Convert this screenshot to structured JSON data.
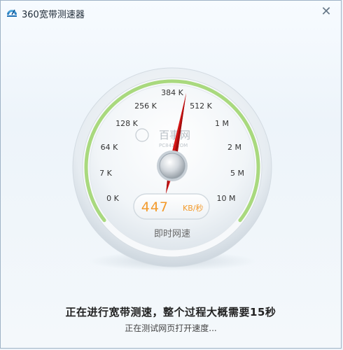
{
  "window": {
    "title": "360宽带测速器",
    "close_glyph": "✕"
  },
  "gauge": {
    "scale_labels": [
      "0 K",
      "7 K",
      "64 K",
      "128 K",
      "256 K",
      "384 K",
      "512 K",
      "1 M",
      "2 M",
      "5 M",
      "10 M"
    ],
    "speed_value": "447",
    "speed_unit": "KB/秒",
    "caption": "即时网速",
    "watermark_main": "百事网",
    "watermark_sub": "PC841.COM",
    "accent_color": "#a9d97e",
    "speed_color": "#f39a2b"
  },
  "status": {
    "main_text": "正在进行宽带测速，整个过程大概需要15秒",
    "sub_text": "正在测试网页打开速度..."
  }
}
